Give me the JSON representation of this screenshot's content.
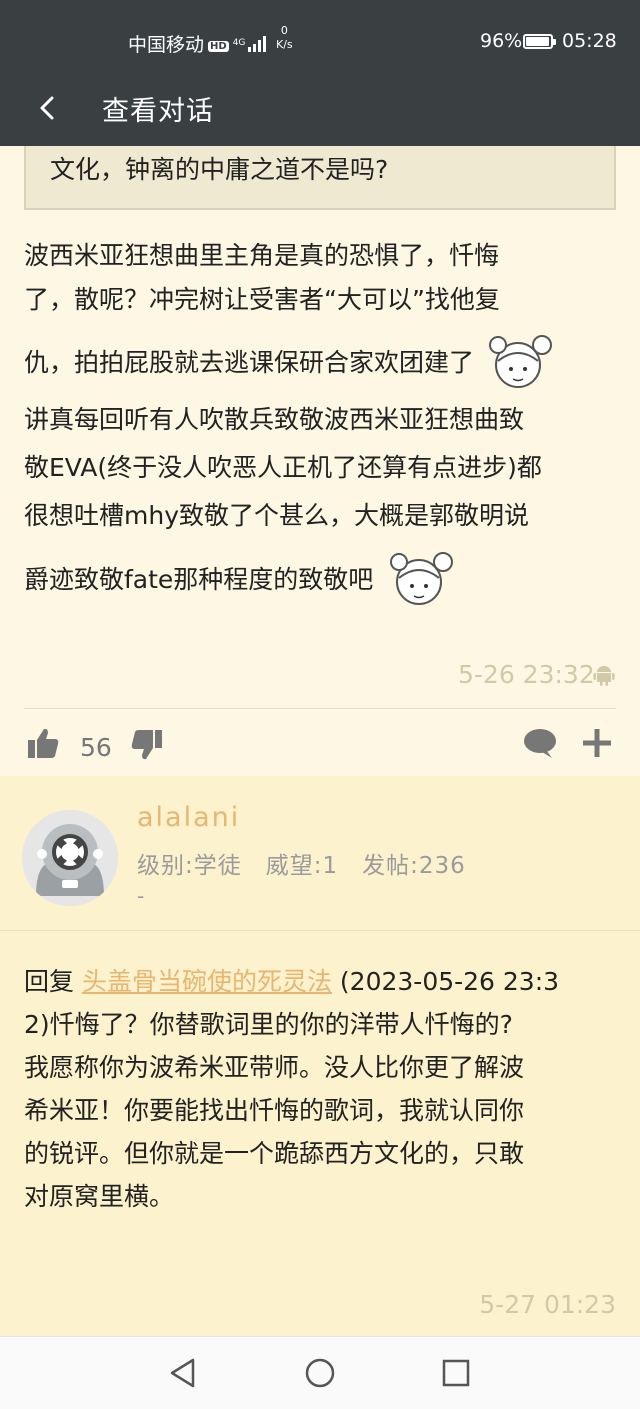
{
  "status_bar": {
    "carrier": "中国移动",
    "hd": "HD",
    "network": "4G",
    "speed_value": "0",
    "speed_unit": "K/s",
    "battery_pct": "96%",
    "battery_level": 0.96,
    "time": "05:28"
  },
  "header": {
    "title": "查看对话"
  },
  "quoted": {
    "text": "文化，钟离的中庸之道不是吗?"
  },
  "post1": {
    "line1": "波西米亚狂想曲里主角是真的恐惧了，忏悔",
    "line2": "了，散呢？冲完树让受害者“大可以”找他复",
    "line3": "仇，拍拍屁股就去逃课保研合家欢团建了",
    "line4": "讲真每回听有人吹散兵致敬波西米亚狂想曲致",
    "line5": "敬EVA(终于没人吹恶人正机了还算有点进步)都",
    "line6": "很想吐槽mhy致敬了个甚么，大概是郭敬明说",
    "line7": "爵迹致敬fate那种程度的致敬吧",
    "time": "5-26 23:32",
    "likes": "56"
  },
  "reply": {
    "username": "alalani",
    "level": "级别:学徒",
    "prestige": "威望:1",
    "posts": "发帖:236",
    "dash": "-",
    "reply_prefix": "回复 ",
    "reply_to": "头盖骨当碗使的死灵法",
    "line1_rest": " (2023-05-26 23:3",
    "line2": "2)忏悔了？你替歌词里的你的洋带人忏悔的?",
    "line3": "我愿称你为波希米亚带师。没人比你更了解波",
    "line4": "希米亚！你要能找出忏悔的歌词，我就认同你",
    "line5": "的锐评。但你就是一个跪舔西方文化的，只敢",
    "line6": "对原窝里横。",
    "time": "5-27 01:23"
  }
}
